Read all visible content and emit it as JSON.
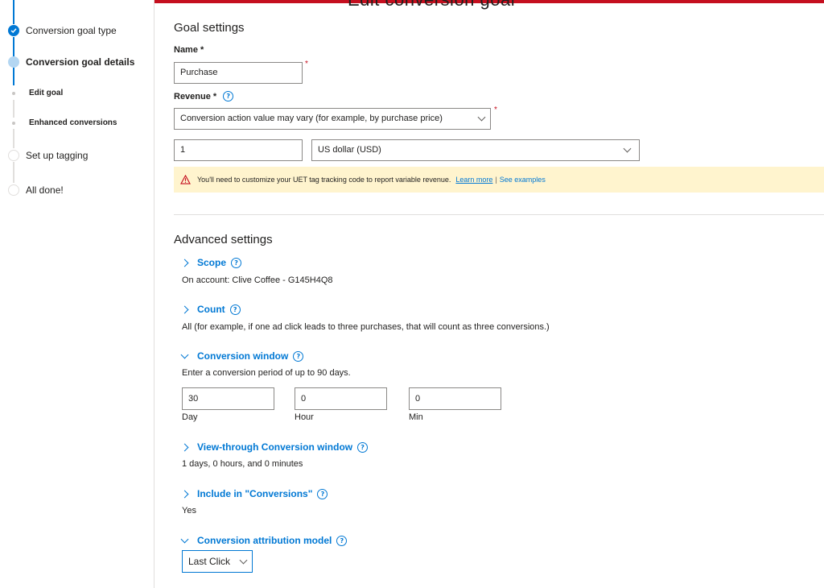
{
  "page": {
    "title_fragment": "Edit conversion goal"
  },
  "sidebar": {
    "steps": [
      {
        "label": "Conversion goal type",
        "state": "done"
      },
      {
        "label": "Conversion goal details",
        "state": "active"
      },
      {
        "label": "Edit goal",
        "state": "sub"
      },
      {
        "label": "Enhanced conversions",
        "state": "sub"
      },
      {
        "label": "Set up tagging",
        "state": "todo"
      },
      {
        "label": "All done!",
        "state": "todo"
      }
    ]
  },
  "goal_settings": {
    "heading": "Goal settings",
    "name_label": "Name *",
    "name_value": "Purchase",
    "revenue_label": "Revenue *",
    "revenue_type_value": "Conversion action value may vary (for example, by purchase price)",
    "revenue_amount_value": "1",
    "currency_value": "US dollar (USD)",
    "warning_text": "You'll need to customize your UET tag tracking code to report variable revenue.",
    "learn_more": "Learn more",
    "separator": "|",
    "see_examples": "See examples"
  },
  "advanced": {
    "heading": "Advanced settings",
    "scope_label": "Scope",
    "scope_value": "On account: Clive Coffee - G145H4Q8",
    "count_label": "Count",
    "count_value": "All (for example, if one ad click leads to three purchases, that will count as three conversions.)",
    "window_label": "Conversion window",
    "window_desc": "Enter a conversion period of up to 90 days.",
    "window_day_value": "30",
    "window_hour_value": "0",
    "window_min_value": "0",
    "day_label": "Day",
    "hour_label": "Hour",
    "min_label": "Min",
    "view_through_label": "View-through Conversion window",
    "view_through_value": "1 days, 0 hours, and 0 minutes",
    "include_label": "Include in \"Conversions\"",
    "include_value": "Yes",
    "attribution_label": "Conversion attribution model",
    "attribution_value": "Last Click"
  },
  "icons": {
    "help": "?",
    "check": "✓"
  },
  "colors": {
    "accent": "#0078d4",
    "brand_bar": "#c50f1f",
    "warning_bg": "#fff4ce"
  }
}
